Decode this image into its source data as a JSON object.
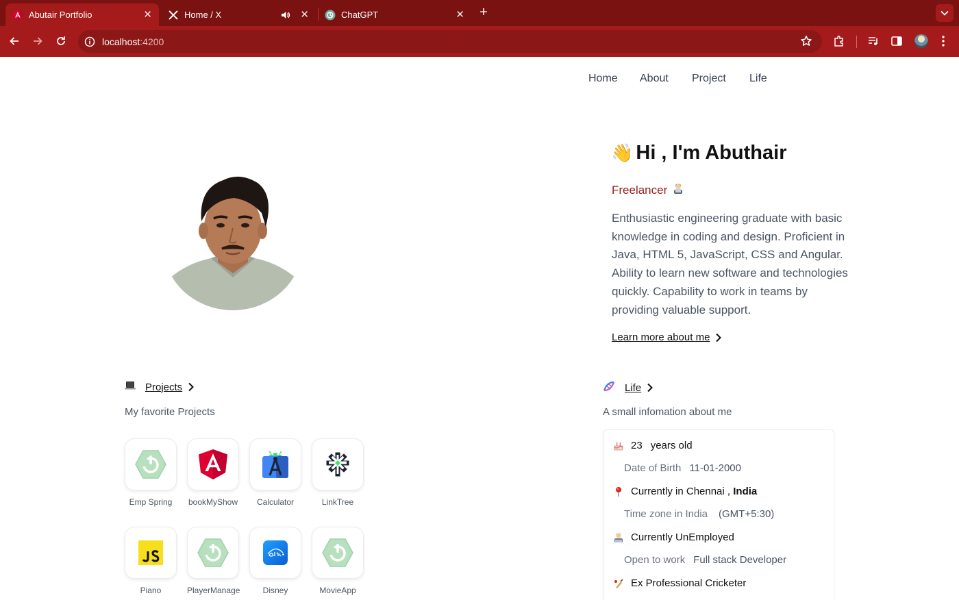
{
  "browser": {
    "tabs": [
      {
        "title": "Abutair Portfolio",
        "icon": "angular-icon",
        "active": true
      },
      {
        "title": "Home / X",
        "icon": "x-logo-icon",
        "active": false
      },
      {
        "title": "ChatGPT",
        "icon": "chatgpt-icon",
        "active": false
      }
    ],
    "url_host": "localhost",
    "url_port": ":4200",
    "theme_color": "#a51a1a"
  },
  "nav": {
    "items": [
      "Home",
      "About",
      "Project",
      "Life"
    ]
  },
  "hero": {
    "greeting_emoji": "👋",
    "title": "Hi , I'm Abuthair",
    "role": "Freelancer",
    "bio": "Enthusiastic engineering graduate with basic knowledge in coding and design. Proficient in Java, HTML 5, JavaScript, CSS and Angular. Ability to learn new software and technologies quickly. Capability to work in teams by providing valuable support.",
    "learn_more": "Learn more about me"
  },
  "projects": {
    "heading": "Projects",
    "subtitle": "My favorite Projects",
    "items": [
      {
        "name": "Emp Spring",
        "icon": "spring-icon"
      },
      {
        "name": "bookMyShow",
        "icon": "angular-icon"
      },
      {
        "name": "Calculator",
        "icon": "android-studio-icon"
      },
      {
        "name": "LinkTree",
        "icon": "linktree-icon"
      },
      {
        "name": "Piano",
        "icon": "javascript-icon"
      },
      {
        "name": "PlayerManage",
        "icon": "spring-icon"
      },
      {
        "name": "Disney",
        "icon": "disney-plus-icon"
      },
      {
        "name": "MovieApp",
        "icon": "spring-icon"
      }
    ]
  },
  "life": {
    "heading": "Life",
    "subtitle": "A small infomation about me",
    "age_value": "23",
    "age_label": "years old",
    "dob_label": "Date of Birth",
    "dob_value": "11-01-2000",
    "location_prefix": "Currently in Chennai",
    "location_sep": " , ",
    "location_country": "India",
    "timezone_label": "Time zone in India",
    "timezone_value": "(GMT+5:30)",
    "employment": "Currently UnEmployed",
    "open_label": "Open to work",
    "open_value": "Full stack Developer",
    "sport": "Ex Professional Cricketer"
  }
}
